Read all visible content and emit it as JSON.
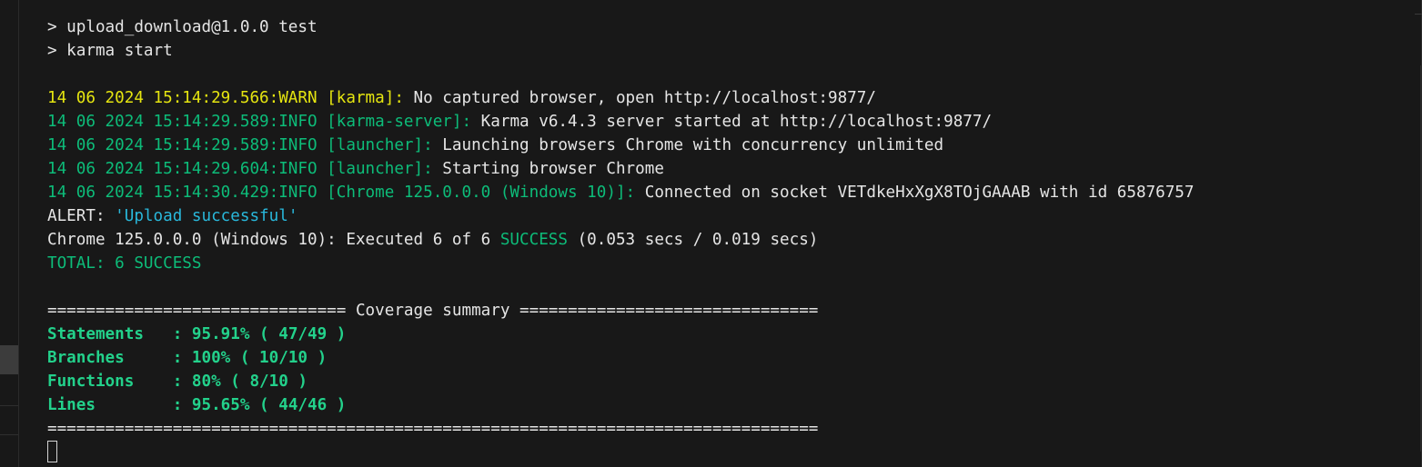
{
  "terminal": {
    "cmd1": "> upload_download@1.0.0 test",
    "cmd2": "> karma start",
    "log": [
      {
        "prefix": "14 06 2024 15:14:29.566:WARN [karma]:",
        "message": " No captured browser, open http://localhost:9877/"
      },
      {
        "prefix": "14 06 2024 15:14:29.589:INFO [karma-server]:",
        "message": " Karma v6.4.3 server started at http://localhost:9877/"
      },
      {
        "prefix": "14 06 2024 15:14:29.589:INFO [launcher]:",
        "message": " Launching browsers Chrome with concurrency unlimited"
      },
      {
        "prefix": "14 06 2024 15:14:29.604:INFO [launcher]:",
        "message": " Starting browser Chrome"
      },
      {
        "prefix": "14 06 2024 15:14:30.429:INFO [Chrome 125.0.0.0 (Windows 10)]:",
        "message": " Connected on socket VETdkeHxXgX8TOjGAAAB with id 65876757"
      }
    ],
    "alert_label": "ALERT: ",
    "alert_text": "'Upload successful'",
    "executed_prefix": "Chrome 125.0.0.0 (Windows 10): Executed 6 of 6 ",
    "executed_success": "SUCCESS",
    "executed_suffix": " (0.053 secs / 0.019 secs)",
    "total": "TOTAL: 6 SUCCESS",
    "coverage_header": "=============================== Coverage summary ===============================",
    "coverage": [
      {
        "label": "Statements   : ",
        "value": "95.91% ( 47/49 )"
      },
      {
        "label": "Branches     : ",
        "value": "100% ( 10/10 )"
      },
      {
        "label": "Functions    : ",
        "value": "80% ( 8/10 )"
      },
      {
        "label": "Lines        : ",
        "value": "95.65% ( 44/46 )"
      }
    ],
    "coverage_footer": "================================================================================"
  },
  "colors": {
    "background": "#181818",
    "warn": "#e5e510",
    "info": "#23d18b",
    "alert_string": "#29b8db",
    "text": "#cccccc"
  }
}
